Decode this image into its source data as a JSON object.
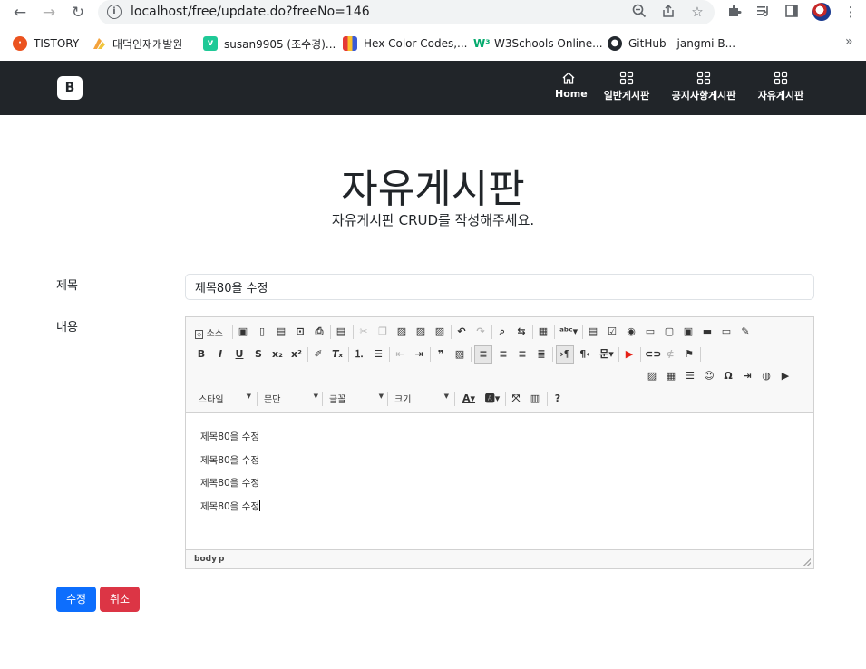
{
  "browser": {
    "url": "localhost/free/update.do?freeNo=146",
    "bookmarks": [
      {
        "label": "TISTORY",
        "icon": "tistory-icon",
        "color": "#eb531f"
      },
      {
        "label": "대덕인재개발원",
        "icon": "ddit-icon",
        "color": "#f4a23b"
      },
      {
        "label": "susan9905 (조수경)...",
        "icon": "velog-icon",
        "color": "#20c997"
      },
      {
        "label": "Hex Color Codes,...",
        "icon": "hexcolor-icon",
        "color": "#3b5bd6"
      },
      {
        "label": "W3Schools Online...",
        "icon": "w3schools-icon",
        "color": "#04aa6d"
      },
      {
        "label": "GitHub - jangmi-B...",
        "icon": "github-icon",
        "color": "#24292f"
      }
    ],
    "more_bookmarks": "»"
  },
  "navbar": {
    "brand": "B",
    "items": [
      {
        "label": "Home",
        "icon": "home-icon"
      },
      {
        "label": "일반게시판",
        "icon": "grid-icon"
      },
      {
        "label": "공지사항게시판",
        "icon": "grid-icon"
      },
      {
        "label": "자유게시판",
        "icon": "grid-icon"
      }
    ]
  },
  "page": {
    "title": "자유게시판",
    "subtitle": "자유게시판 CRUD를 작성해주세요."
  },
  "form": {
    "title_label": "제목",
    "title_value": "제목80을 수정",
    "content_label": "내용",
    "editor": {
      "source_label": "소스",
      "combos": [
        "스타일",
        "문단",
        "글꼴",
        "크기"
      ],
      "lines": [
        "제목80을 수정",
        "제목80을 수정",
        "제목80을 수정",
        "제목80을 수정"
      ],
      "path": [
        "body",
        "p"
      ]
    },
    "submit_label": "수정",
    "cancel_label": "취소"
  },
  "colors": {
    "navbar_bg": "#212529",
    "primary": "#0d6efd",
    "danger": "#dc3545"
  }
}
